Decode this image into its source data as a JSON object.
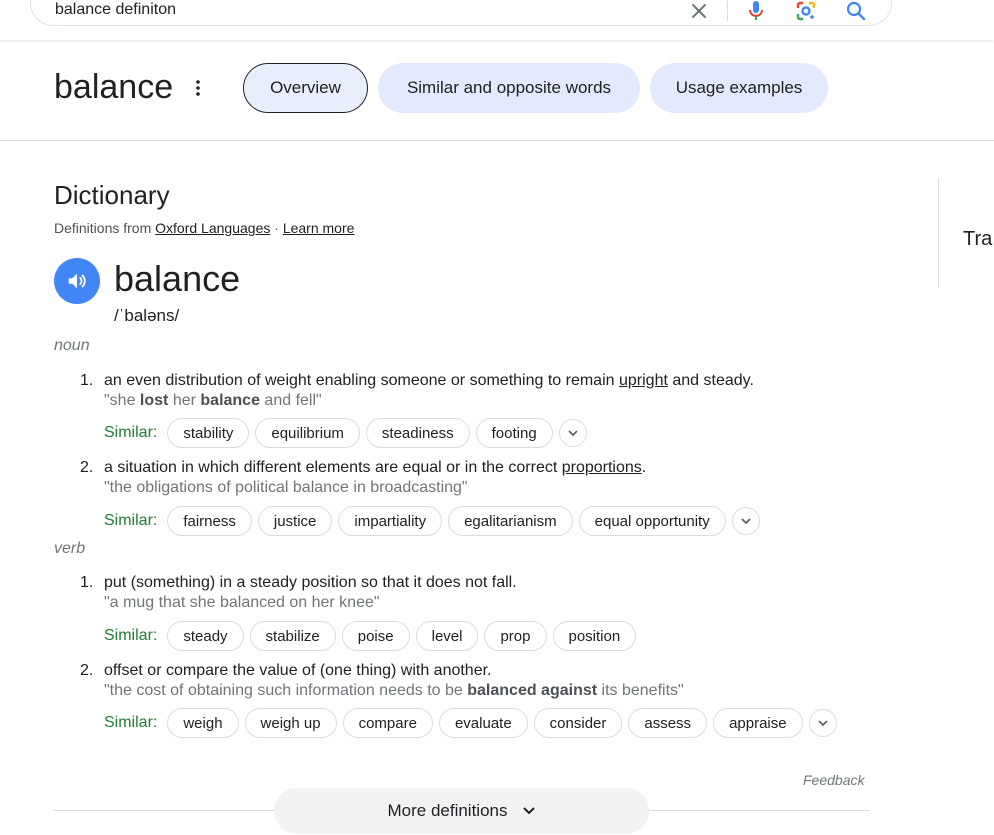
{
  "search": {
    "query": "balance definiton"
  },
  "header": {
    "title": "balance",
    "tabs": [
      {
        "label": "Overview",
        "active": true
      },
      {
        "label": "Similar and opposite words",
        "active": false
      },
      {
        "label": "Usage examples",
        "active": false
      }
    ]
  },
  "dictionary": {
    "heading": "Dictionary",
    "source_prefix": "Definitions from",
    "source_link": "Oxford Languages",
    "separator": "·",
    "learn_more": "Learn more",
    "word": "balance",
    "phonetic": "/ˈbaləns/",
    "similar_label": "Similar:",
    "noun": {
      "label": "noun",
      "senses": [
        {
          "num": "1.",
          "def_before": "an even distribution of weight enabling someone or something to remain ",
          "def_link": "upright",
          "def_after": " and steady.",
          "ex_parts": [
            "\"she ",
            "lost",
            " her ",
            "balance",
            " and fell\""
          ],
          "similar": [
            "stability",
            "equilibrium",
            "steadiness",
            "footing"
          ]
        },
        {
          "num": "2.",
          "def_before": "a situation in which different elements are equal or in the correct ",
          "def_link": "proportions",
          "def_after": ".",
          "example": "\"the obligations of political balance in broadcasting\"",
          "similar": [
            "fairness",
            "justice",
            "impartiality",
            "egalitarianism",
            "equal opportunity"
          ]
        }
      ]
    },
    "verb": {
      "label": "verb",
      "senses": [
        {
          "num": "1.",
          "definition": "put (something) in a steady position so that it does not fall.",
          "example": "\"a mug that she balanced on her knee\"",
          "similar": [
            "steady",
            "stabilize",
            "poise",
            "level",
            "prop",
            "position"
          ]
        },
        {
          "num": "2.",
          "definition": "offset or compare the value of (one thing) with another.",
          "ex_parts": [
            "\"the cost of obtaining such information needs to be ",
            "balanced against",
            " its benefits\""
          ],
          "similar": [
            "weigh",
            "weigh up",
            "compare",
            "evaluate",
            "consider",
            "assess",
            "appraise"
          ]
        }
      ]
    },
    "feedback": "Feedback",
    "more_definitions": "More definitions"
  },
  "right_panel": {
    "text": "Tra"
  },
  "colors": {
    "accent": "#4285f4",
    "similar_label": "#1e7e34",
    "pill_bg": "#e3eafd"
  }
}
